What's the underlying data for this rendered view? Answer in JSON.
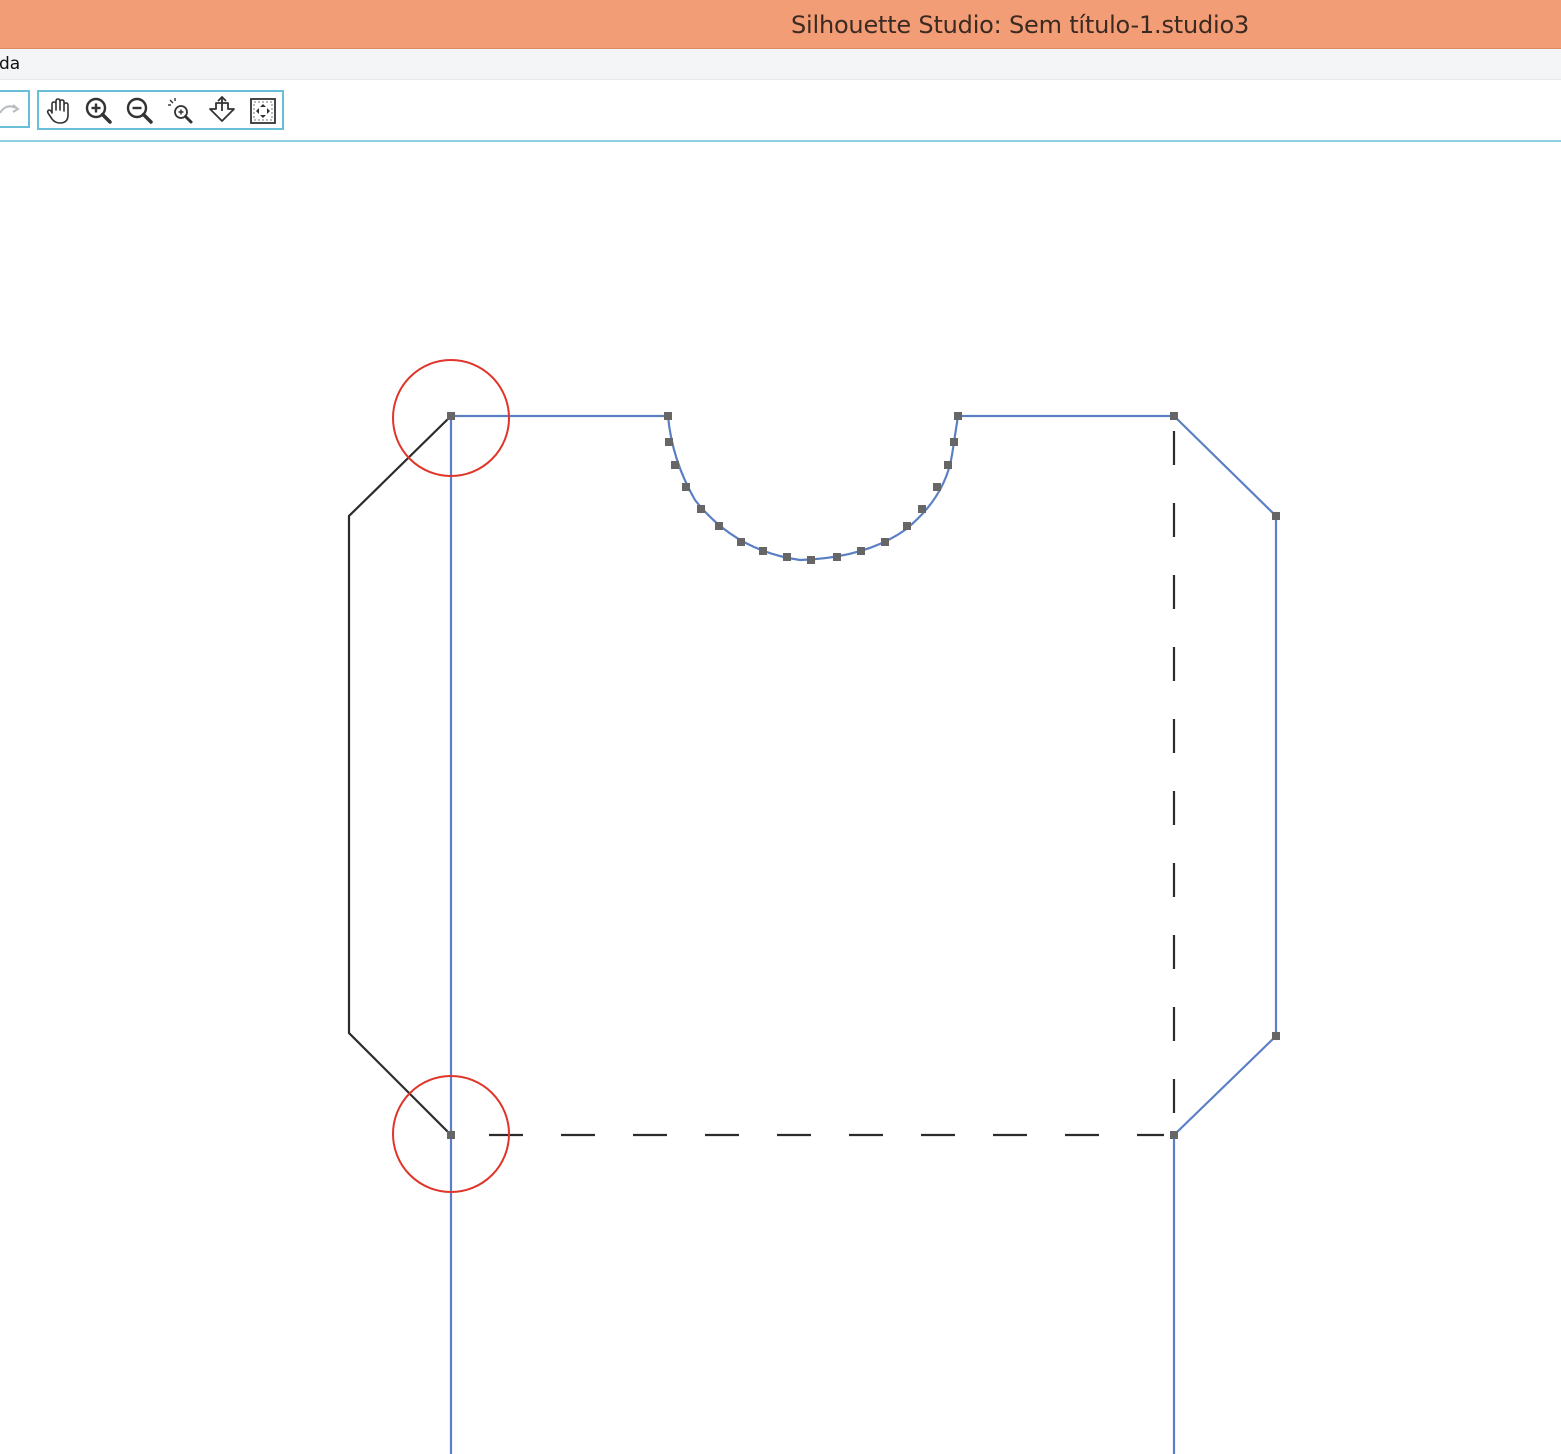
{
  "window": {
    "title": "Silhouette Studio: Sem título-1.studio3",
    "titlebar_color": "#f39d76"
  },
  "menubar": {
    "items": [
      "da"
    ]
  },
  "toolbar": {
    "left_group": {
      "icon": "redo-icon",
      "enabled": false
    },
    "view_tools": [
      {
        "icon": "pan-hand-icon",
        "label": ""
      },
      {
        "icon": "zoom-in-icon",
        "label": ""
      },
      {
        "icon": "zoom-out-icon",
        "label": ""
      },
      {
        "icon": "zoom-select-icon",
        "label": ""
      },
      {
        "icon": "drag-zoom-icon",
        "label": ""
      },
      {
        "icon": "fit-to-page-icon",
        "label": ""
      }
    ],
    "accent_color": "#69bfd8"
  },
  "canvas": {
    "cut_line_color": "#5b7fc4",
    "outline_color": "#2b2b2b",
    "fold_line_color": "#2b2b2b",
    "node_color": "#666666",
    "highlight_circle_color": "#e0352b"
  }
}
